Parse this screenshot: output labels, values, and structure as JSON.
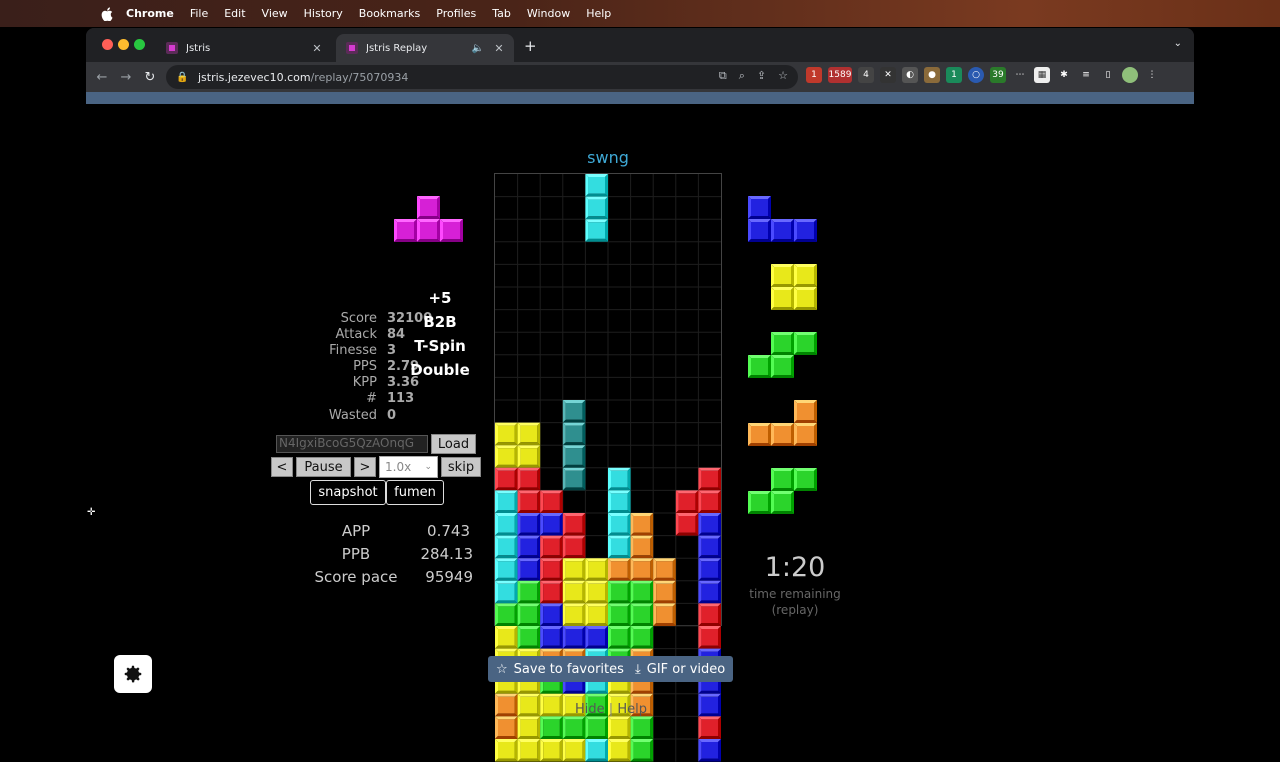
{
  "menubar": {
    "app": "Chrome",
    "items": [
      "File",
      "Edit",
      "View",
      "History",
      "Bookmarks",
      "Profiles",
      "Tab",
      "Window",
      "Help"
    ]
  },
  "tabs": [
    {
      "label": "Jstris",
      "active": false
    },
    {
      "label": "Jstris Replay",
      "active": true
    }
  ],
  "address": {
    "host": "jstris.jezevec10.com",
    "path": "/replay/75070934"
  },
  "extensions_badges": {
    "b1": "1",
    "b2": "1589",
    "b3": "4",
    "b4": "1",
    "b5": "39"
  },
  "colors": {
    "I": "#33dde0",
    "O": "#e8e81a",
    "T": "#d620d6",
    "S": "#2bd42b",
    "Z": "#e0202a",
    "J": "#2222e0",
    "L": "#f09030",
    "G": "#2f8f8f",
    "accent_blue": "#4a6483",
    "player_name": "#3fa9d6"
  },
  "player_name": "swng",
  "stats": {
    "labels": {
      "score": "Score",
      "attack": "Attack",
      "finesse": "Finesse",
      "pps": "PPS",
      "kpp": "KPP",
      "count": "#",
      "wasted": "Wasted"
    },
    "values": {
      "score": "32100",
      "attack": "84",
      "finesse": "3",
      "pps": "2.79",
      "kpp": "3.36",
      "count": "113",
      "wasted": "0"
    }
  },
  "spin_message": {
    "points": "+5",
    "b2b": "B2B",
    "spin": "T-Spin",
    "lines": "Double"
  },
  "controls": {
    "code_value": "N4IgxiBcoG5QzAOnqG",
    "load": "Load",
    "prev": "<",
    "pause": "Pause",
    "next": ">",
    "speed": "1.0x",
    "skip": "skip",
    "snapshot": "snapshot",
    "fumen": "fumen"
  },
  "aux_stats": {
    "app_label": "APP",
    "app_value": "0.743",
    "ppb_label": "PPB",
    "ppb_value": "284.13",
    "pace_label": "Score pace",
    "pace_value": "95949"
  },
  "timer": {
    "time": "1:20",
    "sub1": "time remaining",
    "sub2": "(replay)"
  },
  "hold": "T",
  "queue": [
    "J",
    "O",
    "S",
    "L",
    "S"
  ],
  "board": {
    "rows": [
      "....I.....",
      "....I.....",
      "....I.....",
      "..........",
      "..........",
      "..........",
      "..........",
      "..........",
      "..........",
      "..........",
      "...G......",
      "OO.G......",
      "OO.G......",
      "ZZ.G.I...Z",
      "IZZ..I..ZZ",
      "IJJZ.IL.ZJ",
      "IJZZ.IL..J",
      "IJZOOLLL.J",
      "ISZOOSSL.J",
      "SSJOOSSL.Z",
      "OSJJJSS..Z",
      "OOLLISL..J",
      "OOSJIOL..J",
      "LOOOSOL..J",
      "LOSSSOS..Z",
      "OOOOIOS..J"
    ]
  },
  "bottom_buttons": {
    "favorites": "Save to favorites",
    "gif": "GIF or video"
  },
  "footer": {
    "hide": "Hide",
    "sep": "|",
    "help": "Help"
  }
}
